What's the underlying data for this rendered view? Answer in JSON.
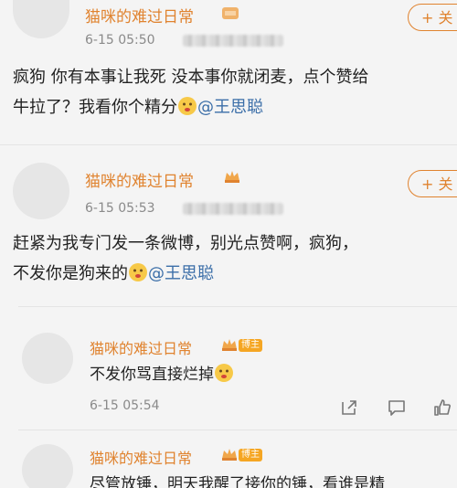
{
  "posts": [
    {
      "username": "猫咪的难过日常",
      "timestamp": "6-15 05:50",
      "follow_label": "+ 关",
      "content_line1": "疯狗 你有本事让我死 没本事你就闭麦，点个赞给",
      "content_line2_text": "牛拉了？我看你个精分",
      "mention": "@王思聪"
    },
    {
      "username": "猫咪的难过日常",
      "timestamp": "6-15 05:53",
      "follow_label": "+ 关",
      "content_line1": "赶紧为我专门发一条微博，别光点赞啊，疯狗，",
      "content_line2_text": "不发你是狗来的",
      "mention": "@王思聪"
    }
  ],
  "replies": [
    {
      "username": "猫咪的难过日常",
      "badge": "博主",
      "content": "不发你骂直接烂掉",
      "timestamp": "6-15 05:54"
    },
    {
      "username": "猫咪的难过日常",
      "badge": "博主",
      "content_partial": "尽管放锤，明天我醒了接你的锤，看谁是精"
    }
  ],
  "icons": [
    "crown-icon",
    "emoji-face-icon",
    "share-icon",
    "comment-icon",
    "like-icon"
  ],
  "colors": {
    "username": "#e0832f",
    "mention": "#3b6ea8",
    "badge": "#f5a623"
  }
}
